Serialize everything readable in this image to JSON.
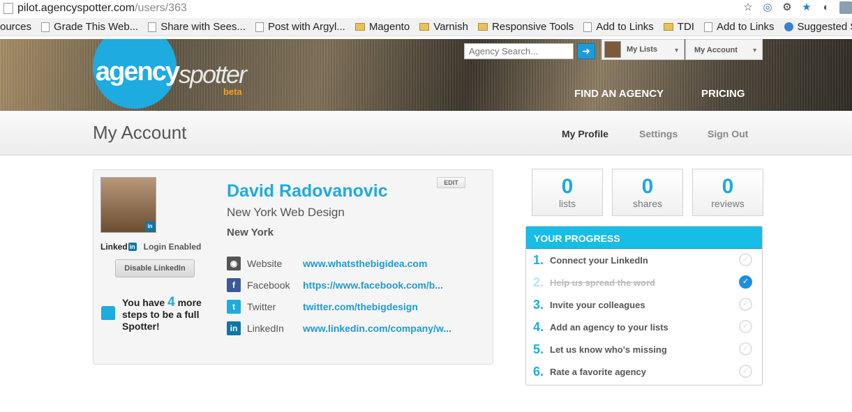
{
  "browser": {
    "url_domain": "pilot.agencyspotter.com",
    "url_path": "/users/363",
    "icons": [
      "star-icon",
      "extension-icon",
      "gear-icon",
      "bookmark-star-icon",
      "extension2-icon",
      "profile-icon"
    ]
  },
  "bookmarks": [
    {
      "label": "ources",
      "icon": "none"
    },
    {
      "label": "Grade This Web...",
      "icon": "page"
    },
    {
      "label": "Share with Sees...",
      "icon": "page"
    },
    {
      "label": "Post with Argyl...",
      "icon": "page"
    },
    {
      "label": "Magento",
      "icon": "folder"
    },
    {
      "label": "Varnish",
      "icon": "folder"
    },
    {
      "label": "Responsive Tools",
      "icon": "folder"
    },
    {
      "label": "Add to Links",
      "icon": "page"
    },
    {
      "label": "TDI",
      "icon": "folder"
    },
    {
      "label": "Add to Links",
      "icon": "page"
    },
    {
      "label": "Suggested Sit",
      "icon": "ie"
    }
  ],
  "header": {
    "logo_main": "agency",
    "logo_second": "spotter",
    "logo_beta": "beta",
    "search_placeholder": "Agency Search...",
    "search_button": "➜",
    "my_lists": "My Lists",
    "my_account": "My Account",
    "nav": [
      "FIND AN AGENCY",
      "PRICING"
    ]
  },
  "subheader": {
    "title": "My Account",
    "nav": [
      "My Profile",
      "Settings",
      "Sign Out"
    ]
  },
  "profile": {
    "name": "David Radovanovic",
    "company": "New York Web Design",
    "city": "New York",
    "edit_label": "EDIT",
    "linkedin_badge": "in",
    "linkedin_word": "Linked",
    "linkedin_in": "in",
    "login_status": "Login Enabled",
    "disable_button": "Disable LinkedIn",
    "steps_prefix": "You have",
    "steps_count": "4",
    "steps_suffix": "more steps to be a full Spotter!",
    "links": [
      {
        "label": "Website",
        "value": "www.whatsthebigidea.com",
        "icon": "globe-icon",
        "glyph": "◉",
        "color": "#555555"
      },
      {
        "label": "Facebook",
        "value": "https://www.facebook.com/b...",
        "icon": "facebook-icon",
        "glyph": "f",
        "color": "#3b5998"
      },
      {
        "label": "Twitter",
        "value": "twitter.com/thebigdesign",
        "icon": "twitter-icon",
        "glyph": "t",
        "color": "#1dabe0"
      },
      {
        "label": "LinkedIn",
        "value": "www.linkedin.com/company/w...",
        "icon": "linkedin-icon",
        "glyph": "in",
        "color": "#0e76a8"
      }
    ]
  },
  "stats": [
    {
      "value": "0",
      "label": "lists"
    },
    {
      "value": "0",
      "label": "shares"
    },
    {
      "value": "0",
      "label": "reviews"
    }
  ],
  "progress": {
    "title": "YOUR PROGRESS",
    "items": [
      {
        "num": "1.",
        "text": "Connect your LinkedIn",
        "done": false
      },
      {
        "num": "2.",
        "text": "Help us spread the word",
        "done": true
      },
      {
        "num": "3.",
        "text": "Invite your colleagues",
        "done": false
      },
      {
        "num": "4.",
        "text": "Add an agency to your lists",
        "done": false
      },
      {
        "num": "5.",
        "text": "Let us know who's missing",
        "done": false
      },
      {
        "num": "6.",
        "text": "Rate a favorite agency",
        "done": false
      }
    ]
  }
}
